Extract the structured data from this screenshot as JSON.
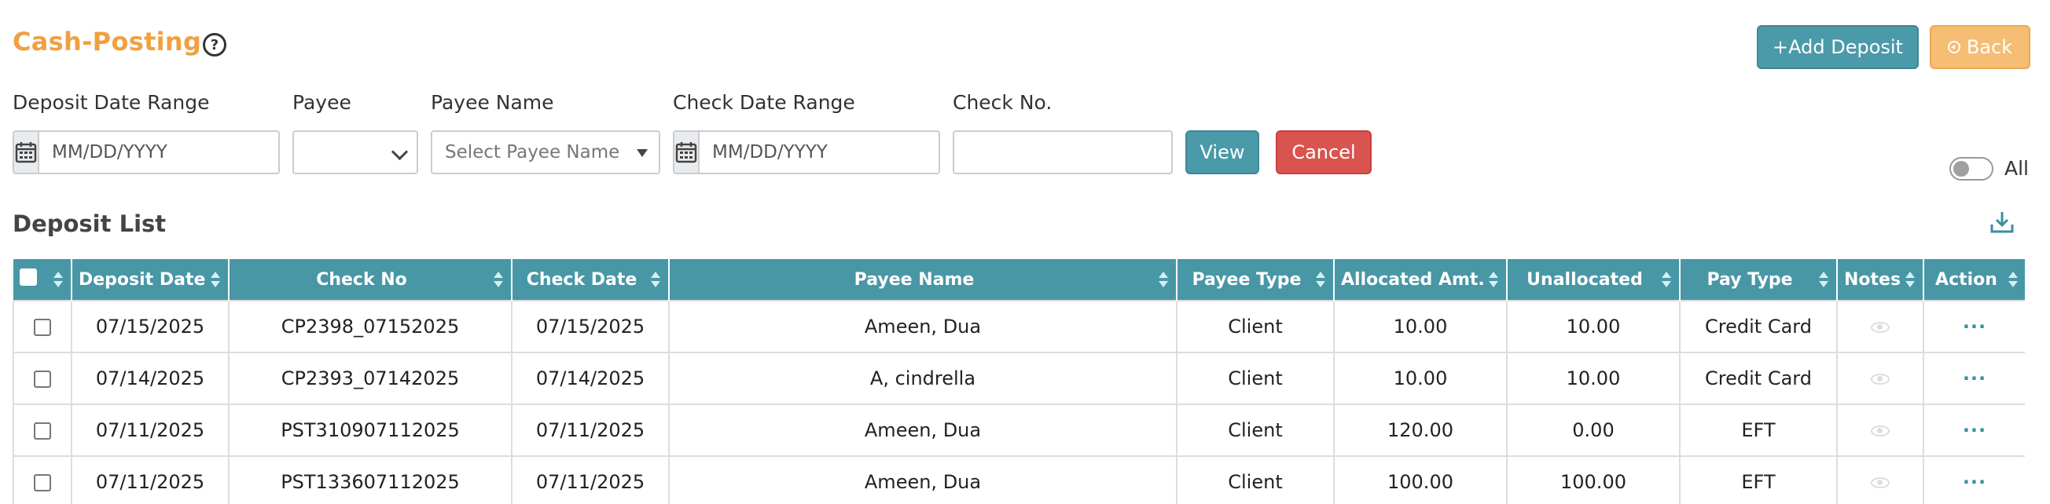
{
  "header": {
    "title": "Cash-Posting",
    "help_icon": "question-circle-icon",
    "add_deposit_label": "+Add Deposit",
    "back_label": "Back"
  },
  "filters": {
    "deposit_date_range": {
      "label": "Deposit Date Range",
      "placeholder": "MM/DD/YYYY"
    },
    "payee": {
      "label": "Payee",
      "value": ""
    },
    "payee_name": {
      "label": "Payee Name",
      "placeholder": "Select Payee Name"
    },
    "check_date_range": {
      "label": "Check Date Range",
      "placeholder": "MM/DD/YYYY"
    },
    "check_no": {
      "label": "Check No.",
      "value": ""
    },
    "view_label": "View",
    "cancel_label": "Cancel",
    "all_toggle": {
      "label": "All",
      "on": false
    }
  },
  "deposit_list": {
    "title": "Deposit List",
    "columns": [
      "Deposit Date",
      "Check No",
      "Check Date",
      "Payee Name",
      "Payee Type",
      "Allocated Amt.",
      "Unallocated",
      "Pay Type",
      "Notes",
      "Action"
    ],
    "rows": [
      {
        "deposit_date": "07/15/2025",
        "check_no": "CP2398_07152025",
        "check_date": "07/15/2025",
        "payee_name": "Ameen, Dua",
        "payee_type": "Client",
        "allocated": "10.00",
        "unallocated": "10.00",
        "pay_type": "Credit Card",
        "action": "···"
      },
      {
        "deposit_date": "07/14/2025",
        "check_no": "CP2393_07142025",
        "check_date": "07/14/2025",
        "payee_name": "A, cindrella",
        "payee_type": "Client",
        "allocated": "10.00",
        "unallocated": "10.00",
        "pay_type": "Credit Card",
        "action": "···"
      },
      {
        "deposit_date": "07/11/2025",
        "check_no": "PST310907112025",
        "check_date": "07/11/2025",
        "payee_name": "Ameen, Dua",
        "payee_type": "Client",
        "allocated": "120.00",
        "unallocated": "0.00",
        "pay_type": "EFT",
        "action": "···"
      },
      {
        "deposit_date": "07/11/2025",
        "check_no": "PST133607112025",
        "check_date": "07/11/2025",
        "payee_name": "Ameen, Dua",
        "payee_type": "Client",
        "allocated": "100.00",
        "unallocated": "100.00",
        "pay_type": "EFT",
        "action": "···"
      }
    ]
  },
  "colors": {
    "title": "#f0a040",
    "primary": "#4a9aaa",
    "header_bg": "#4897a6",
    "back": "#f6bd74",
    "danger": "#d9534f"
  }
}
